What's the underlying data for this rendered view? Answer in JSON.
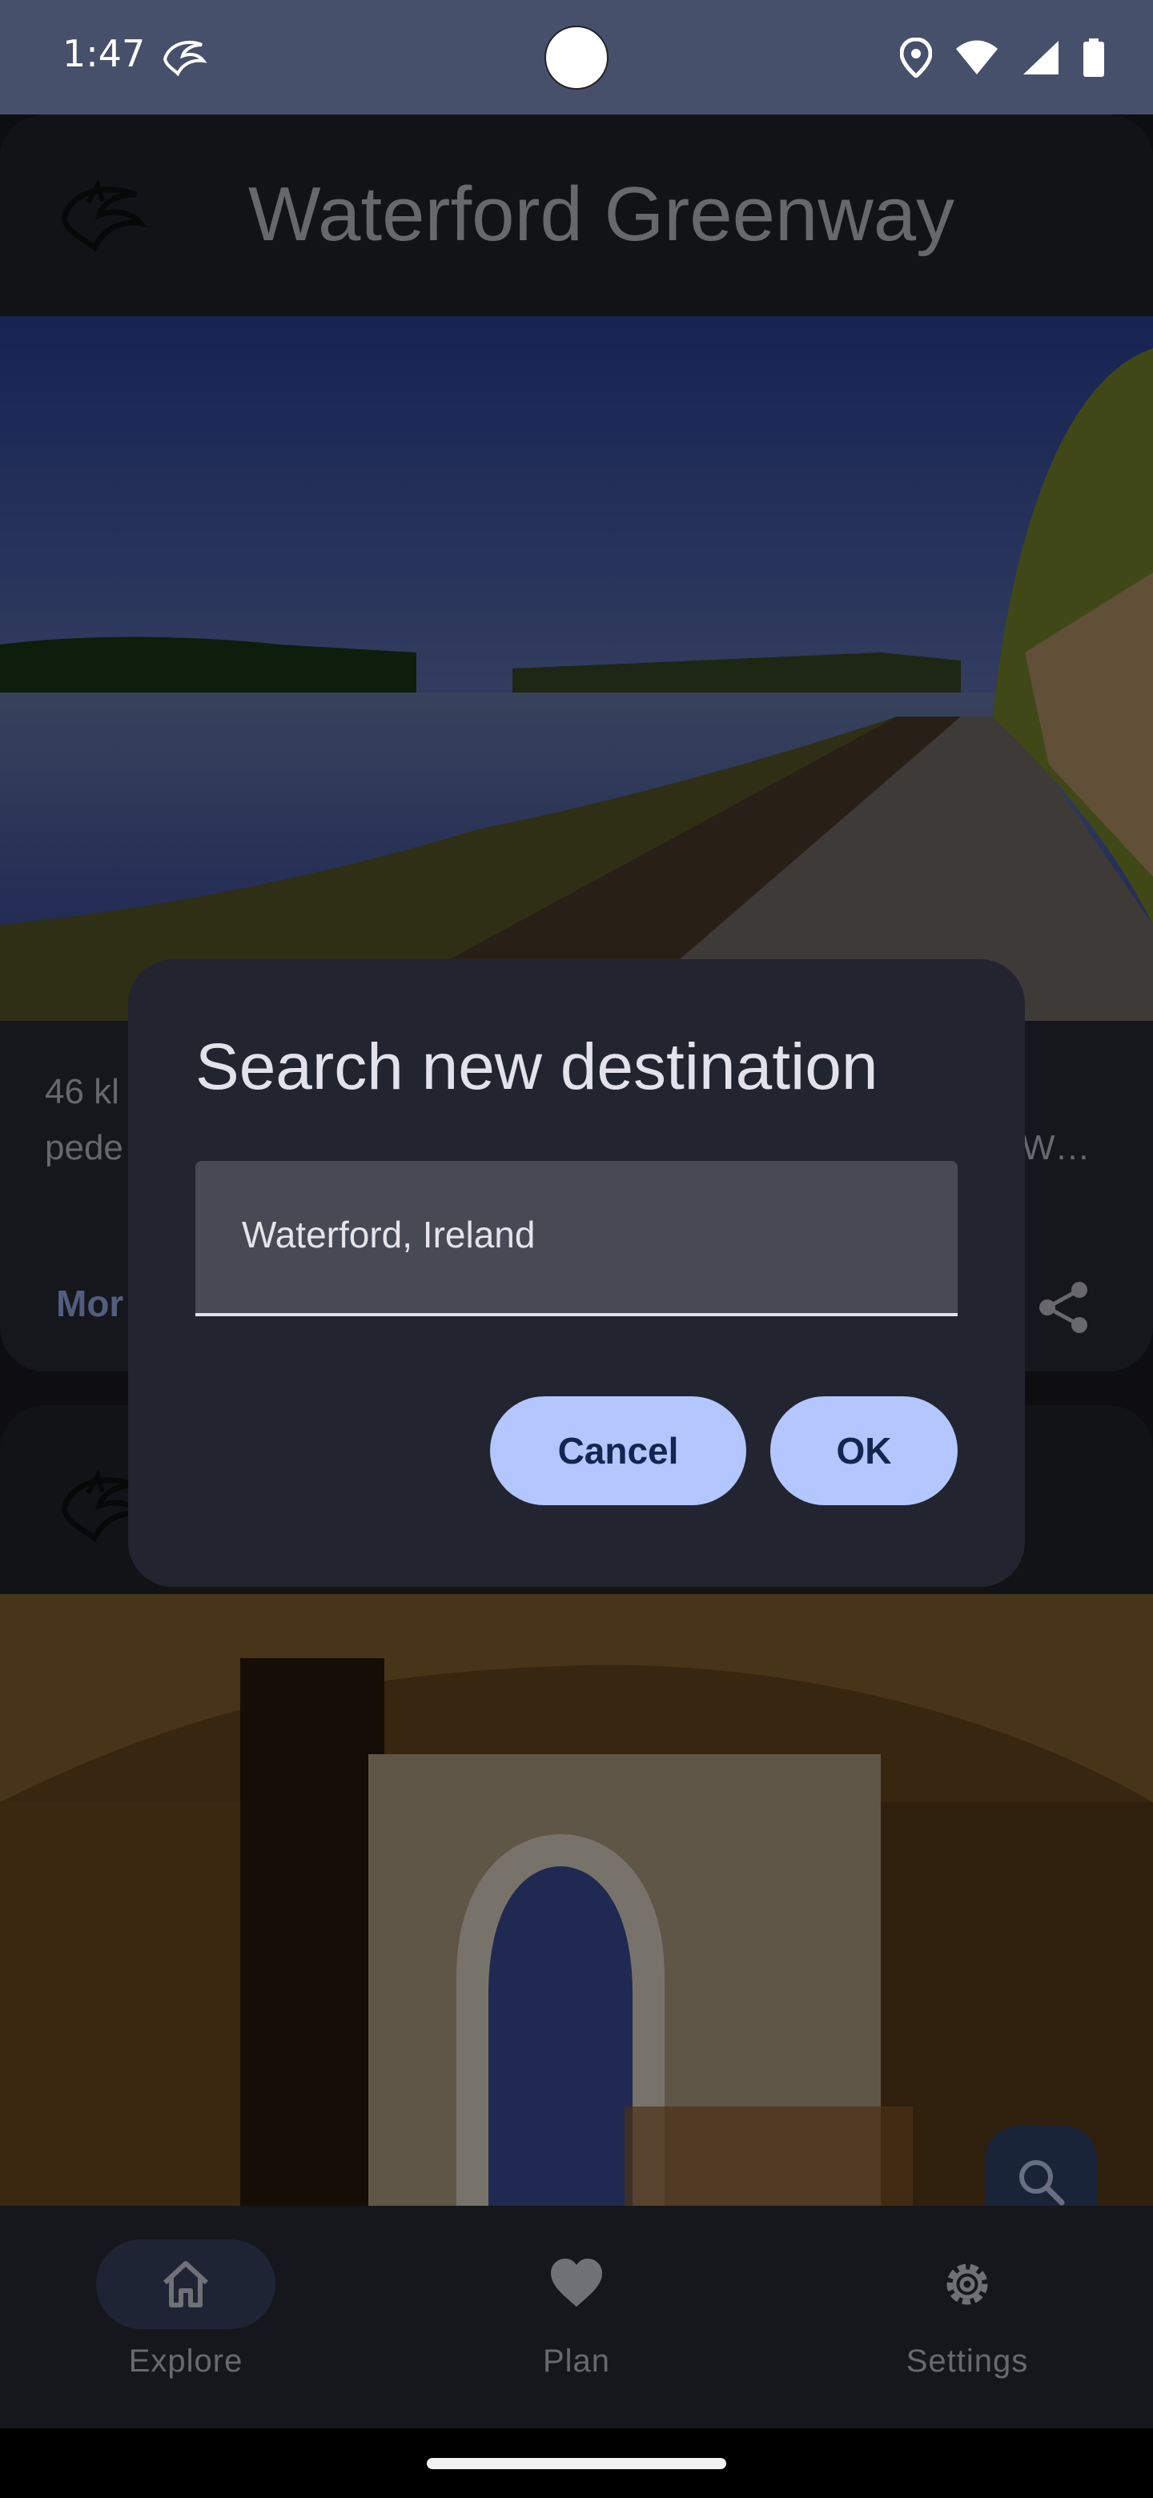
{
  "status_bar": {
    "time": "1:47",
    "icons": [
      "app-notification-icon",
      "location-icon",
      "wifi-icon",
      "signal-icon",
      "battery-icon"
    ]
  },
  "cards": [
    {
      "title": "Waterford Greenway",
      "description": "46 kl… pede… …W…",
      "description_left": "46 kl",
      "description_left_line2": "pede",
      "description_right": "W…",
      "more_label": "Mor"
    },
    {
      "title": ""
    }
  ],
  "dialog": {
    "title": "Search new destination",
    "field_value": "Waterford, Ireland",
    "cancel_label": "Cancel",
    "ok_label": "OK"
  },
  "bottom_nav": {
    "items": [
      {
        "label": "Explore",
        "icon": "home-icon",
        "selected": true
      },
      {
        "label": "Plan",
        "icon": "heart-icon",
        "selected": false
      },
      {
        "label": "Settings",
        "icon": "gear-icon",
        "selected": false
      }
    ]
  },
  "colors": {
    "status_bar": "#46506a",
    "dialog_bg": "#22252f",
    "button_bg": "#b3c6ff",
    "button_text": "#14264f",
    "nav_pill": "#3d4666"
  }
}
